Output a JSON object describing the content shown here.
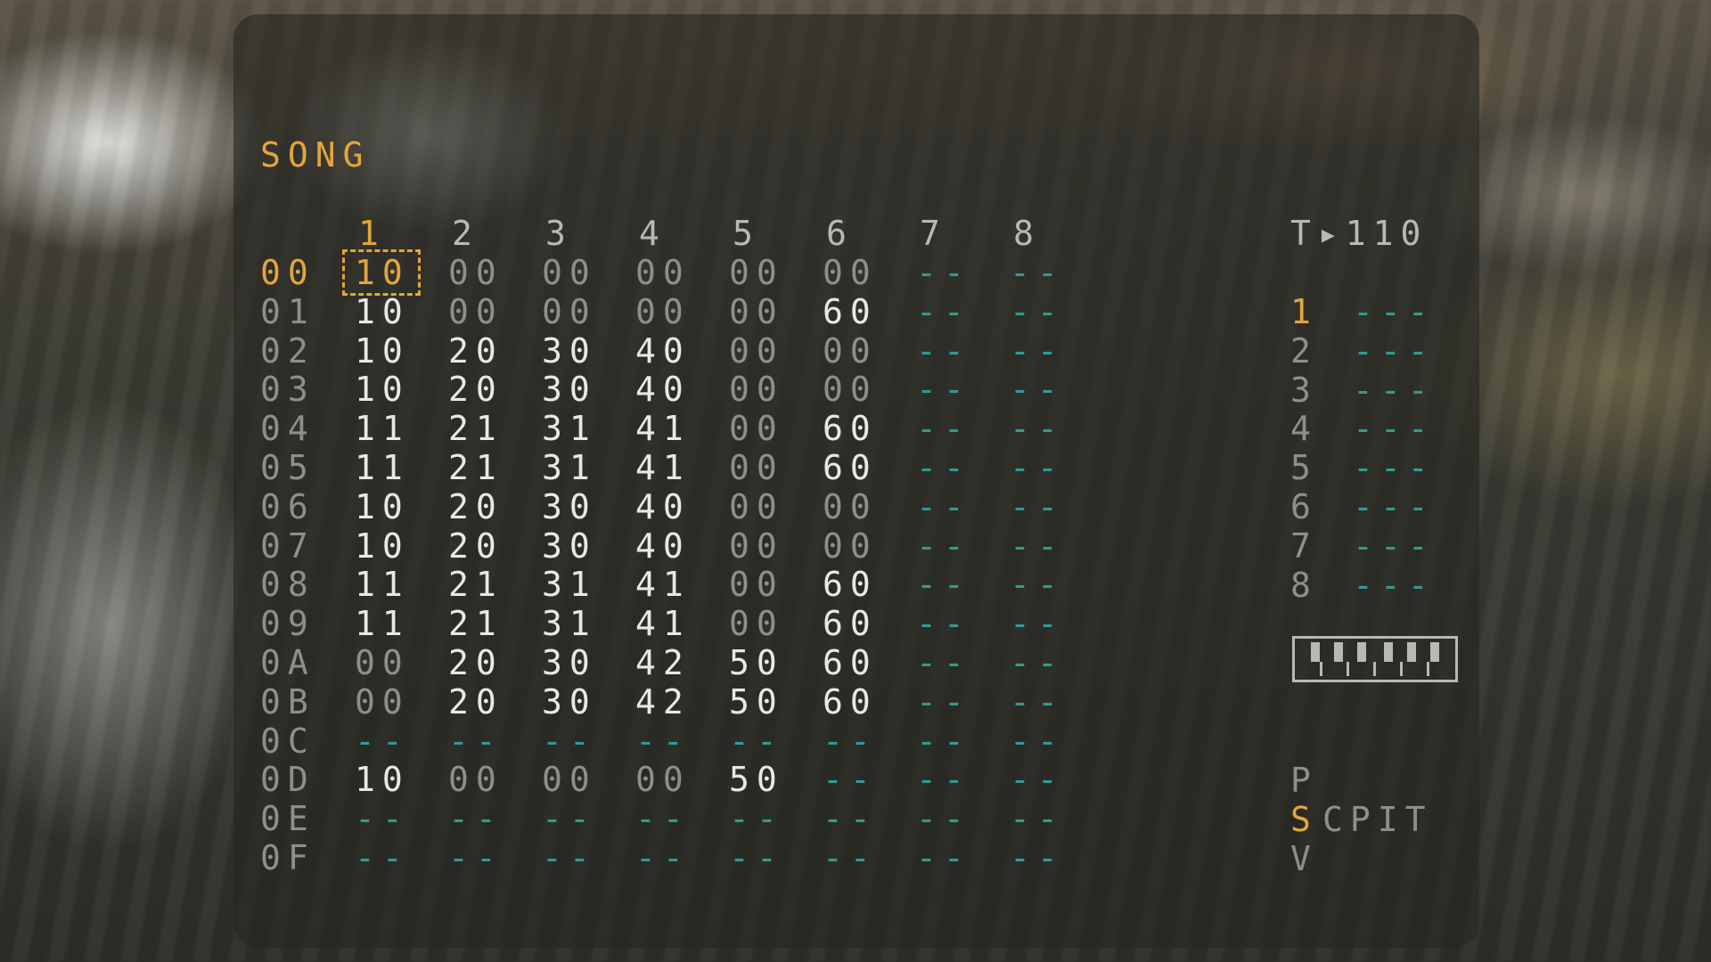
{
  "screen_title": "SONG",
  "tempo_label": "T▸110",
  "track_headers": [
    "1",
    "2",
    "3",
    "4",
    "5",
    "6",
    "7",
    "8"
  ],
  "rows": [
    {
      "index": "00",
      "cells": [
        "10",
        "00",
        "00",
        "00",
        "00",
        "00",
        "--",
        "--"
      ]
    },
    {
      "index": "01",
      "cells": [
        "10",
        "00",
        "00",
        "00",
        "00",
        "60",
        "--",
        "--"
      ]
    },
    {
      "index": "02",
      "cells": [
        "10",
        "20",
        "30",
        "40",
        "00",
        "00",
        "--",
        "--"
      ]
    },
    {
      "index": "03",
      "cells": [
        "10",
        "20",
        "30",
        "40",
        "00",
        "00",
        "--",
        "--"
      ]
    },
    {
      "index": "04",
      "cells": [
        "11",
        "21",
        "31",
        "41",
        "00",
        "60",
        "--",
        "--"
      ]
    },
    {
      "index": "05",
      "cells": [
        "11",
        "21",
        "31",
        "41",
        "00",
        "60",
        "--",
        "--"
      ]
    },
    {
      "index": "06",
      "cells": [
        "10",
        "20",
        "30",
        "40",
        "00",
        "00",
        "--",
        "--"
      ]
    },
    {
      "index": "07",
      "cells": [
        "10",
        "20",
        "30",
        "40",
        "00",
        "00",
        "--",
        "--"
      ]
    },
    {
      "index": "08",
      "cells": [
        "11",
        "21",
        "31",
        "41",
        "00",
        "60",
        "--",
        "--"
      ]
    },
    {
      "index": "09",
      "cells": [
        "11",
        "21",
        "31",
        "41",
        "00",
        "60",
        "--",
        "--"
      ]
    },
    {
      "index": "0A",
      "cells": [
        "00",
        "20",
        "30",
        "42",
        "50",
        "60",
        "--",
        "--"
      ]
    },
    {
      "index": "0B",
      "cells": [
        "00",
        "20",
        "30",
        "42",
        "50",
        "60",
        "--",
        "--"
      ]
    },
    {
      "index": "0C",
      "cells": [
        "--",
        "--",
        "--",
        "--",
        "--",
        "--",
        "--",
        "--"
      ]
    },
    {
      "index": "0D",
      "cells": [
        "10",
        "00",
        "00",
        "00",
        "50",
        "--",
        "--",
        "--"
      ]
    },
    {
      "index": "0E",
      "cells": [
        "--",
        "--",
        "--",
        "--",
        "--",
        "--",
        "--",
        "--"
      ]
    },
    {
      "index": "0F",
      "cells": [
        "--",
        "--",
        "--",
        "--",
        "--",
        "--",
        "--",
        "--"
      ]
    }
  ],
  "cursor": {
    "row": 0,
    "column": 1
  },
  "side_tracks": [
    {
      "num": "1",
      "value": "---"
    },
    {
      "num": "2",
      "value": "---"
    },
    {
      "num": "3",
      "value": "---"
    },
    {
      "num": "4",
      "value": "---"
    },
    {
      "num": "5",
      "value": "---"
    },
    {
      "num": "6",
      "value": "---"
    },
    {
      "num": "7",
      "value": "---"
    },
    {
      "num": "8",
      "value": "---"
    }
  ],
  "active_side_track": "1",
  "screen_map": {
    "row1": "P",
    "row2_active": "S",
    "row2_rest": "CPIT",
    "row3": "V"
  },
  "colors": {
    "accent": "#e3a53b",
    "empty": "#2e9c94",
    "text": "#e8e8e8",
    "dim": "#8e8e8e"
  },
  "icons": [
    "keyboard-icon"
  ]
}
